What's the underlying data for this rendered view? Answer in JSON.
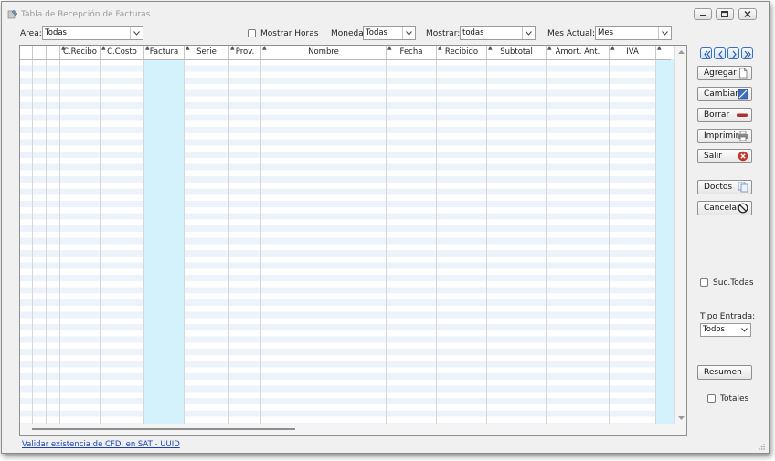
{
  "window": {
    "title": "Tabla de Recepción de Facturas"
  },
  "filters": {
    "area_label": "Area:",
    "area_value": "Todas",
    "mostrar_horas_label": "Mostrar Horas",
    "moneda_label": "Moneda:",
    "moneda_value": "Todas",
    "mostrar_label": "Mostrar:",
    "mostrar_value": "todas",
    "mes_actual_label": "Mes Actual:",
    "mes_actual_value": "Mes"
  },
  "table": {
    "columns": [
      "C.Recibo",
      "C.Costo",
      "Factura",
      "Serie",
      "Prov.",
      "Nombre",
      "Fecha",
      "Recibido",
      "Subtotal",
      "Amort. Ant.",
      "IVA"
    ],
    "rows": []
  },
  "actions": {
    "agregar": "Agregar",
    "cambiar": "Cambiar",
    "borrar": "Borrar",
    "imprimir": "Imprimir",
    "salir": "Salir",
    "doctos": "Doctos",
    "cancelar": "Cancelar",
    "resumen": "Resumen"
  },
  "side": {
    "suc_todas_label": "Suc.Todas",
    "tipo_entrada_label": "Tipo Entrada:",
    "tipo_entrada_value": "Todos",
    "totales_label": "Totales"
  },
  "footer": {
    "validate_link": "Validar existencia de CFDI en SAT - UUID"
  },
  "colors": {
    "highlight_column": "#d4f2fb",
    "row_stripe": "#ecf3fb",
    "link": "#1a3fb5",
    "nav_button_border": "#3a6fb5",
    "salir_icon": "#c0392b",
    "borrar_icon": "#b03030"
  }
}
